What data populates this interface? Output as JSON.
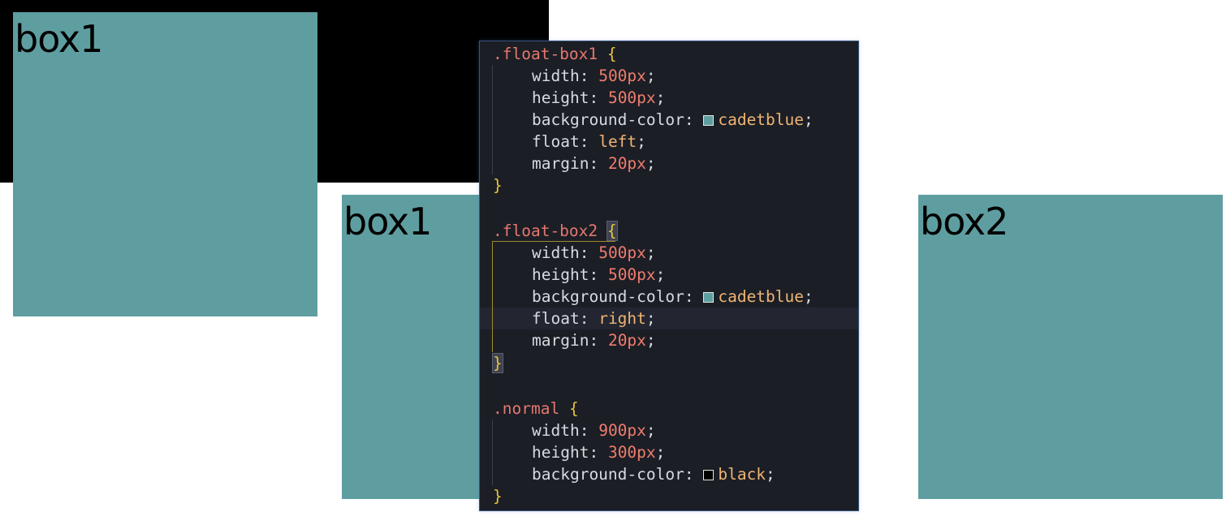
{
  "page": {
    "boxes": [
      {
        "label": "box1",
        "color": "#5f9ea0"
      },
      {
        "label": "box1",
        "color": "#5f9ea0"
      },
      {
        "label": "box2",
        "color": "#5f9ea0"
      }
    ],
    "normal_bg": "#000000"
  },
  "editor": {
    "colors": {
      "background": "#1b1e25",
      "selector": "#e5776f",
      "brace": "#e8c33a",
      "number": "#f07c6e",
      "keyword": "#f0b475",
      "text": "#d7dae0"
    },
    "rules": [
      {
        "selector": ".float-box1",
        "open": "{",
        "close": "}",
        "decls": [
          {
            "prop": "width",
            "value": "500px"
          },
          {
            "prop": "height",
            "value": "500px"
          },
          {
            "prop": "background-color",
            "value": "cadetblue",
            "swatch": "#5f9ea0"
          },
          {
            "prop": "float",
            "value": "left"
          },
          {
            "prop": "margin",
            "value": "20px"
          }
        ]
      },
      {
        "selector": ".float-box2",
        "open": "{",
        "close": "}",
        "decls": [
          {
            "prop": "width",
            "value": "500px"
          },
          {
            "prop": "height",
            "value": "500px"
          },
          {
            "prop": "background-color",
            "value": "cadetblue",
            "swatch": "#5f9ea0"
          },
          {
            "prop": "float",
            "value": "right"
          },
          {
            "prop": "margin",
            "value": "20px"
          }
        ]
      },
      {
        "selector": ".normal",
        "open": "{",
        "close": "}",
        "decls": [
          {
            "prop": "width",
            "value": "900px"
          },
          {
            "prop": "height",
            "value": "300px"
          },
          {
            "prop": "background-color",
            "value": "black",
            "swatch": "#000000"
          }
        ]
      }
    ],
    "colon": ":",
    "semicolon": ";"
  }
}
